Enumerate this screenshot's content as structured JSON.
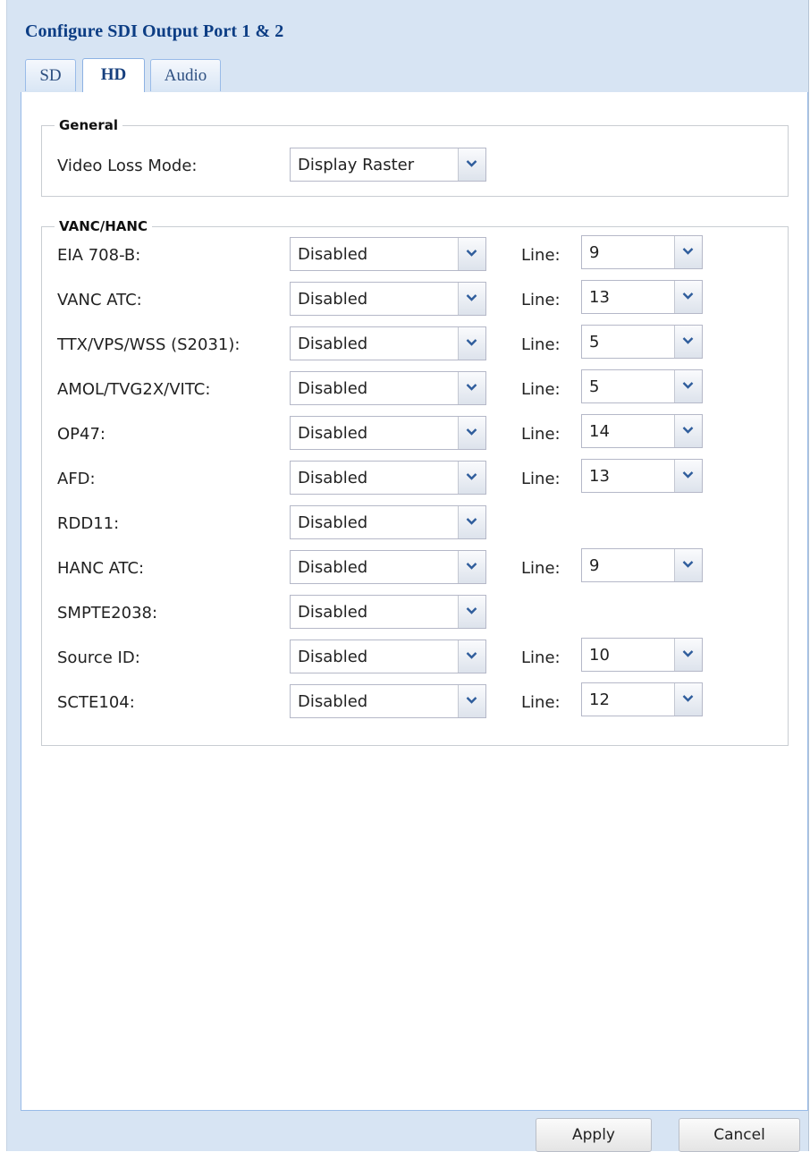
{
  "window": {
    "title": "Configure SDI Output Port 1 & 2"
  },
  "tabs": [
    {
      "label": "SD",
      "active": false
    },
    {
      "label": "HD",
      "active": true
    },
    {
      "label": "Audio",
      "active": false
    }
  ],
  "general": {
    "legend": "General",
    "video_loss_mode": {
      "label": "Video Loss Mode:",
      "value": "Display Raster"
    }
  },
  "vanc_hanc": {
    "legend": "VANC/HANC",
    "line_label": "Line:",
    "rows": [
      {
        "label": "EIA 708-B:",
        "value": "Disabled",
        "line": "9"
      },
      {
        "label": "VANC ATC:",
        "value": "Disabled",
        "line": "13"
      },
      {
        "label": "TTX/VPS/WSS (S2031):",
        "value": "Disabled",
        "line": "5"
      },
      {
        "label": "AMOL/TVG2X/VITC:",
        "value": "Disabled",
        "line": "5"
      },
      {
        "label": "OP47:",
        "value": "Disabled",
        "line": "14"
      },
      {
        "label": "AFD:",
        "value": "Disabled",
        "line": "13"
      },
      {
        "label": "RDD11:",
        "value": "Disabled"
      },
      {
        "label": "HANC ATC:",
        "value": "Disabled",
        "line": "9"
      },
      {
        "label": "SMPTE2038:",
        "value": "Disabled"
      },
      {
        "label": "Source ID:",
        "value": "Disabled",
        "line": "10"
      },
      {
        "label": "SCTE104:",
        "value": "Disabled",
        "line": "12"
      }
    ]
  },
  "buttons": {
    "apply": "Apply",
    "cancel": "Cancel"
  },
  "icons": {
    "combo_trigger": "chevron-down-icon"
  },
  "colors": {
    "title": "#0c3d84",
    "window_bg": "#d7e4f3",
    "tab_border": "#99bbe8"
  }
}
